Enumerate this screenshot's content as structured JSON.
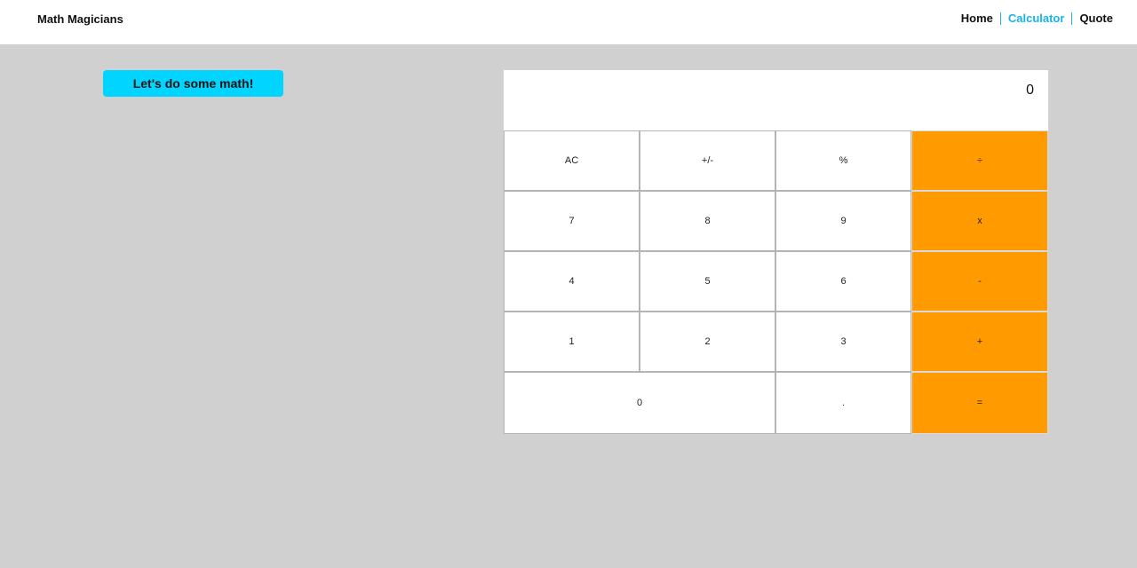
{
  "header": {
    "logo": "Math Magicians",
    "nav": [
      {
        "label": "Home",
        "active": false
      },
      {
        "label": "Calculator",
        "active": true
      },
      {
        "label": "Quote",
        "active": false
      }
    ]
  },
  "main": {
    "intro_button": "Let's do some math!"
  },
  "calculator": {
    "display": "0",
    "keys": [
      {
        "label": "AC",
        "type": "function"
      },
      {
        "label": "+/-",
        "type": "function"
      },
      {
        "label": "%",
        "type": "function"
      },
      {
        "label": "÷",
        "type": "operator"
      },
      {
        "label": "7",
        "type": "digit"
      },
      {
        "label": "8",
        "type": "digit"
      },
      {
        "label": "9",
        "type": "digit"
      },
      {
        "label": "x",
        "type": "operator"
      },
      {
        "label": "4",
        "type": "digit"
      },
      {
        "label": "5",
        "type": "digit"
      },
      {
        "label": "6",
        "type": "digit"
      },
      {
        "label": "-",
        "type": "operator"
      },
      {
        "label": "1",
        "type": "digit"
      },
      {
        "label": "2",
        "type": "digit"
      },
      {
        "label": "3",
        "type": "digit"
      },
      {
        "label": "+",
        "type": "operator"
      },
      {
        "label": "0",
        "type": "digit"
      },
      {
        "label": ".",
        "type": "digit"
      },
      {
        "label": "=",
        "type": "operator"
      }
    ]
  },
  "colors": {
    "page_background": "#d0d0d0",
    "accent": "#00d4ff",
    "nav_active": "#16b4e8",
    "operator": "#ff9a00"
  }
}
